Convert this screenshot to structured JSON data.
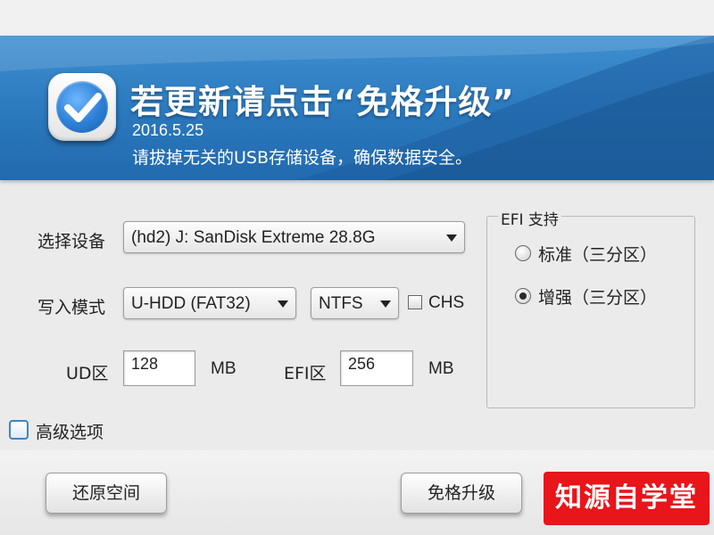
{
  "banner": {
    "title": "若更新请点击“免格升级”",
    "date": "2016.5.25",
    "subtitle": "请拔掉无关的USB存储设备，确保数据安全。",
    "icon": "check-icon"
  },
  "device": {
    "label": "选择设备",
    "value": "(hd2) J: SanDisk Extreme 28.8G"
  },
  "write_mode": {
    "label": "写入模式",
    "mode_value": "U-HDD (FAT32)",
    "fs_value": "NTFS",
    "chs_label": "CHS",
    "chs_checked": false
  },
  "partitions": {
    "ud_label": "UD区",
    "ud_value": "128",
    "ud_unit": "MB",
    "efi_label": "EFI区",
    "efi_value": "256",
    "efi_unit": "MB"
  },
  "efi_support": {
    "title": "EFI 支持",
    "options": [
      {
        "label": "标准（三分区）",
        "selected": false
      },
      {
        "label": "增强（三分区）",
        "selected": true
      }
    ]
  },
  "advanced": {
    "label": "高级选项",
    "checked": false
  },
  "buttons": {
    "restore": "还原空间",
    "upgrade": "免格升级"
  },
  "watermark": "知源自学堂",
  "colors": {
    "banner": "#2a78bd",
    "watermark_bg": "#e8151b",
    "advanced_checkbox_border": "#3a86c6"
  }
}
